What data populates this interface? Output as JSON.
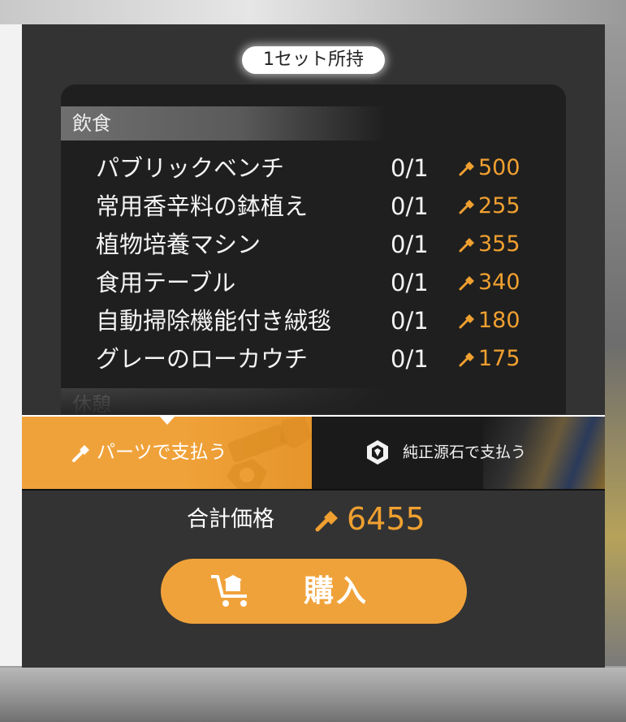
{
  "owned_badge": "1セット所持",
  "category": {
    "title": "飲食",
    "next_title": "休憩"
  },
  "items": [
    {
      "name": "パブリックベンチ",
      "count": "0/1",
      "price": "500"
    },
    {
      "name": "常用香辛料の鉢植え",
      "count": "0/1",
      "price": "255"
    },
    {
      "name": "植物培養マシン",
      "count": "0/1",
      "price": "355"
    },
    {
      "name": "食用テーブル",
      "count": "0/1",
      "price": "340"
    },
    {
      "name": "自動掃除機能付き絨毯",
      "count": "0/1",
      "price": "180"
    },
    {
      "name": "グレーのローカウチ",
      "count": "0/1",
      "price": "175"
    }
  ],
  "payment": {
    "parts_label": "パーツで支払う",
    "stone_label": "純正源石で支払う",
    "selected": "parts"
  },
  "total": {
    "label": "合計価格",
    "value": "6455"
  },
  "buy_button": {
    "label": "購入"
  },
  "colors": {
    "accent": "#f0a23a",
    "price_text": "#f0a030",
    "panel_bg": "#333333",
    "list_bg": "#1f1f1f"
  },
  "icons": {
    "price": "hammer-icon",
    "stone": "originium-icon",
    "buy": "cart-icon"
  }
}
